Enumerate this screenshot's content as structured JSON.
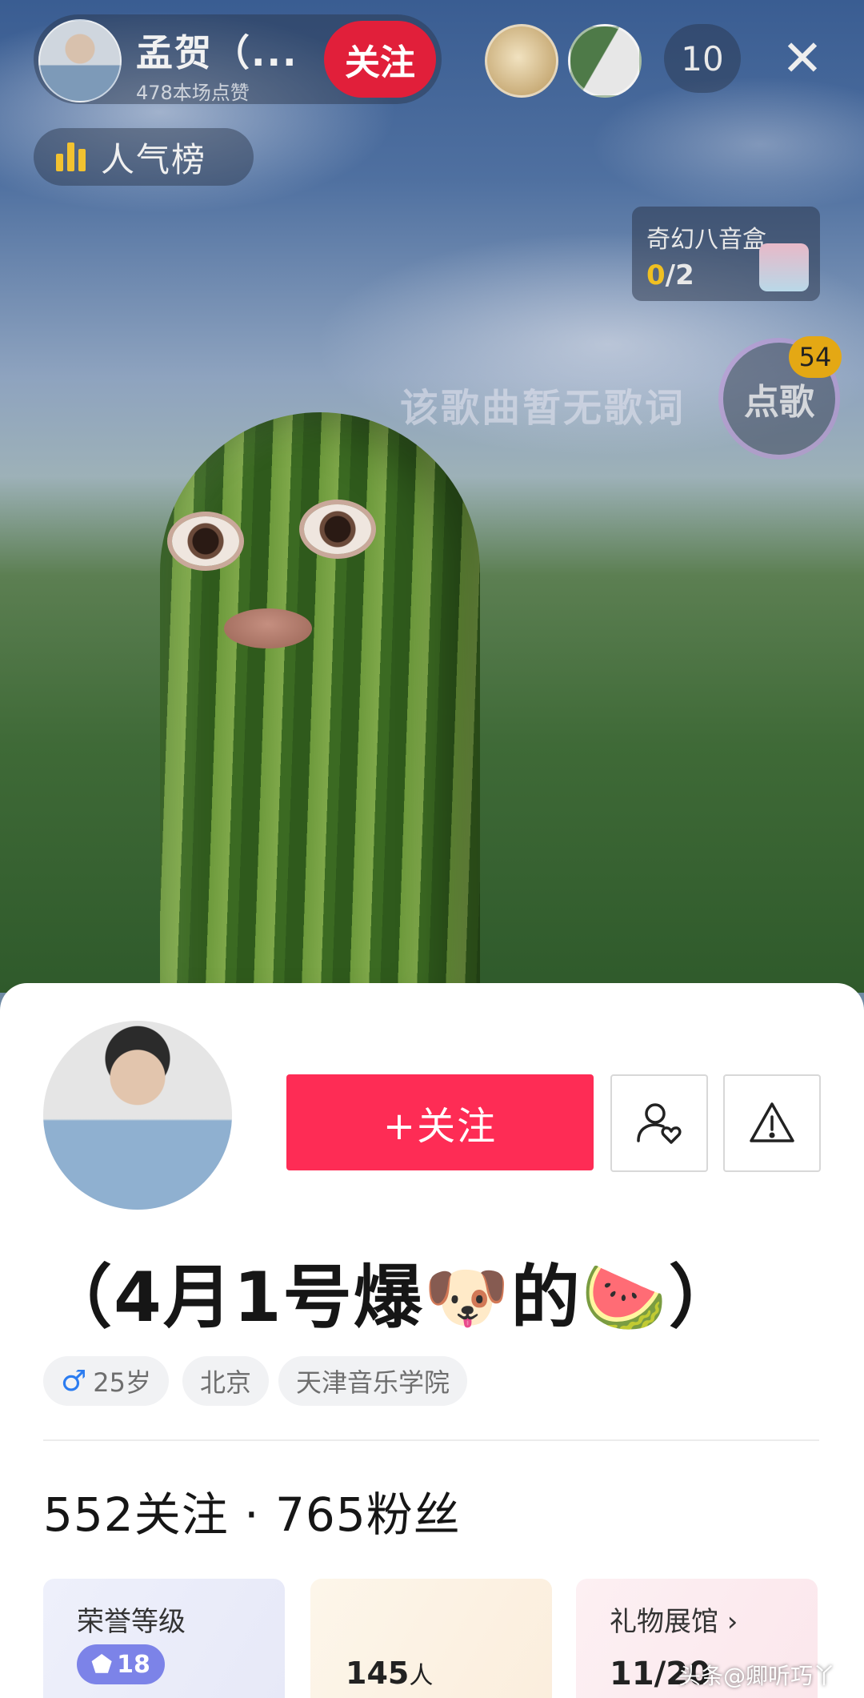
{
  "live": {
    "host": {
      "name": "孟贺（...",
      "likes": "478本场点赞",
      "follow_label": "关注"
    },
    "viewer_count": "10",
    "close_label": "✕",
    "rank_label": "人气榜",
    "music_box": {
      "title": "奇幻八音盒",
      "progress_current": "0",
      "progress_total": "/2"
    },
    "lyric_text": "该歌曲暂无歌词",
    "song_button_label": "点歌",
    "song_badge": "54"
  },
  "profile": {
    "follow_button_label": "+关注",
    "nickname": "（4月1号爆🐶的🍉）",
    "tags": {
      "gender_symbol": "♂",
      "age": "25岁",
      "city": "北京",
      "school": "天津音乐学院"
    },
    "stats": "552关注 · 765粉丝",
    "cards": {
      "honor_title": "荣誉等级",
      "honor_level": "18",
      "fans_count": "145",
      "fans_unit": "人",
      "gifts_title": "礼物展馆 ›",
      "gifts_count": "11/20"
    }
  },
  "watermark": "头条@卿听巧丫",
  "colors": {
    "follow_red": "#fe2c55",
    "live_follow_red": "#e11f3a",
    "gender_blue": "#2b7cf0",
    "level_badge": "#7c83e8",
    "music_progress_gold": "#f0c021"
  }
}
